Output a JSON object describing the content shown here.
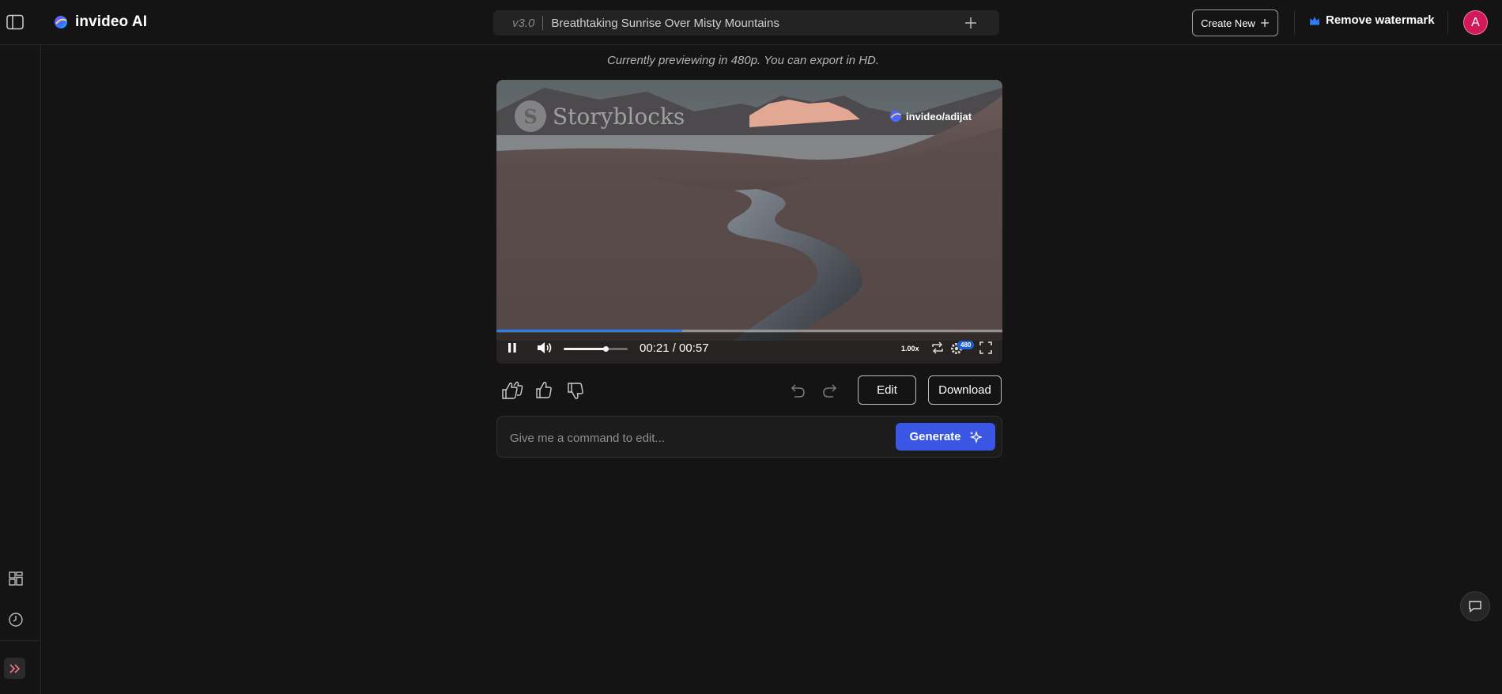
{
  "app": {
    "name": "invideo AI"
  },
  "header": {
    "version": "v3.0",
    "project_title": "Breathtaking Sunrise Over Misty Mountains",
    "create_new_label": "Create New",
    "remove_watermark_label": "Remove watermark",
    "avatar_initial": "A"
  },
  "preview": {
    "note": "Currently previewing in 480p. You can export in HD."
  },
  "player": {
    "watermark_brand": "Storyblocks",
    "watermark_logo_letter": "S",
    "watermark_invideo": "invideo/adijat",
    "current_time": "00:21",
    "duration": "00:57",
    "time_display": "00:21 / 00:57",
    "progress": 0.367,
    "volume": 0.65,
    "speed": "1.00x",
    "resolution_badge": "480",
    "colors": {
      "progress": "#2b7de9",
      "badge": "#1a5fd6"
    }
  },
  "actions": {
    "edit_label": "Edit",
    "download_label": "Download"
  },
  "command": {
    "placeholder": "Give me a command to edit...",
    "generate_label": "Generate"
  },
  "icons": {
    "sidebar_toggle": "sidebar-toggle-icon",
    "plus": "plus-icon",
    "crown": "crown-icon",
    "grid": "grid-icon",
    "history": "clock-icon",
    "expand": "chevrons-right-icon",
    "chat": "chat-icon",
    "pause": "pause-icon",
    "volume": "volume-icon",
    "loop": "loop-icon",
    "settings": "gear-icon",
    "fullscreen": "fullscreen-icon",
    "sparkle": "sparkle-icon"
  },
  "theme": {
    "accent": "#3a56e4",
    "avatar": "#d21a5a",
    "background": "#141414"
  }
}
